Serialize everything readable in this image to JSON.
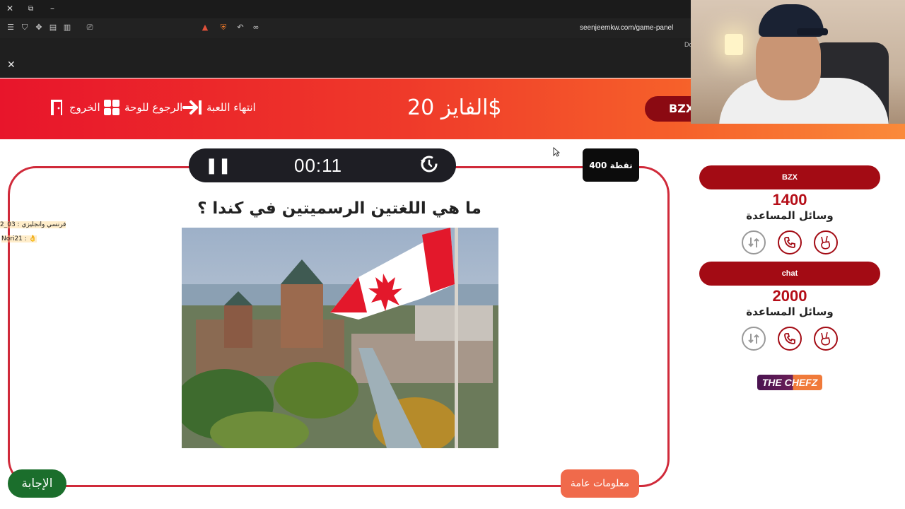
{
  "browser": {
    "url": "seenjeemkw.com/game-panel",
    "url_tail": "Do"
  },
  "header": {
    "exit_label": "الخروج",
    "board_label": "الرجوع للوحة",
    "end_label": "انتهاء اللعبة",
    "prize": "الفايز 20$",
    "team_pill": "BZX"
  },
  "question": {
    "timer": "00:11",
    "points": "400 نقطة",
    "text": "ما هي اللغتين الرسميتين في كندا ؟",
    "category": "معلومات عامة",
    "answer_label": "الإجابة"
  },
  "chat": {
    "line1": "فرنسي وانجليزي : 03_2",
    "line2": "Nori21 : 👌"
  },
  "teams": [
    {
      "name": "BZX",
      "score": "1400",
      "aids_label": "وسائل المساعدة"
    },
    {
      "name": "chat",
      "score": "2000",
      "aids_label": "وسائل المساعدة"
    }
  ],
  "logo": "THE CHEFZ",
  "colors": {
    "header_start": "#e8152b",
    "header_end": "#fa8a3a",
    "team_bar": "#a30b14",
    "answer_button": "#1b6e2c",
    "category_badge": "#f06a4b",
    "timer_bg": "#1e1e24"
  },
  "icons": {
    "exit": "door-exit-icon",
    "board": "grid-icon",
    "end": "arrow-to-line-icon",
    "pause": "pause-icon",
    "reset": "history-icon",
    "aids": [
      "swap-icon",
      "phone-icon",
      "peace-hand-icon"
    ]
  }
}
